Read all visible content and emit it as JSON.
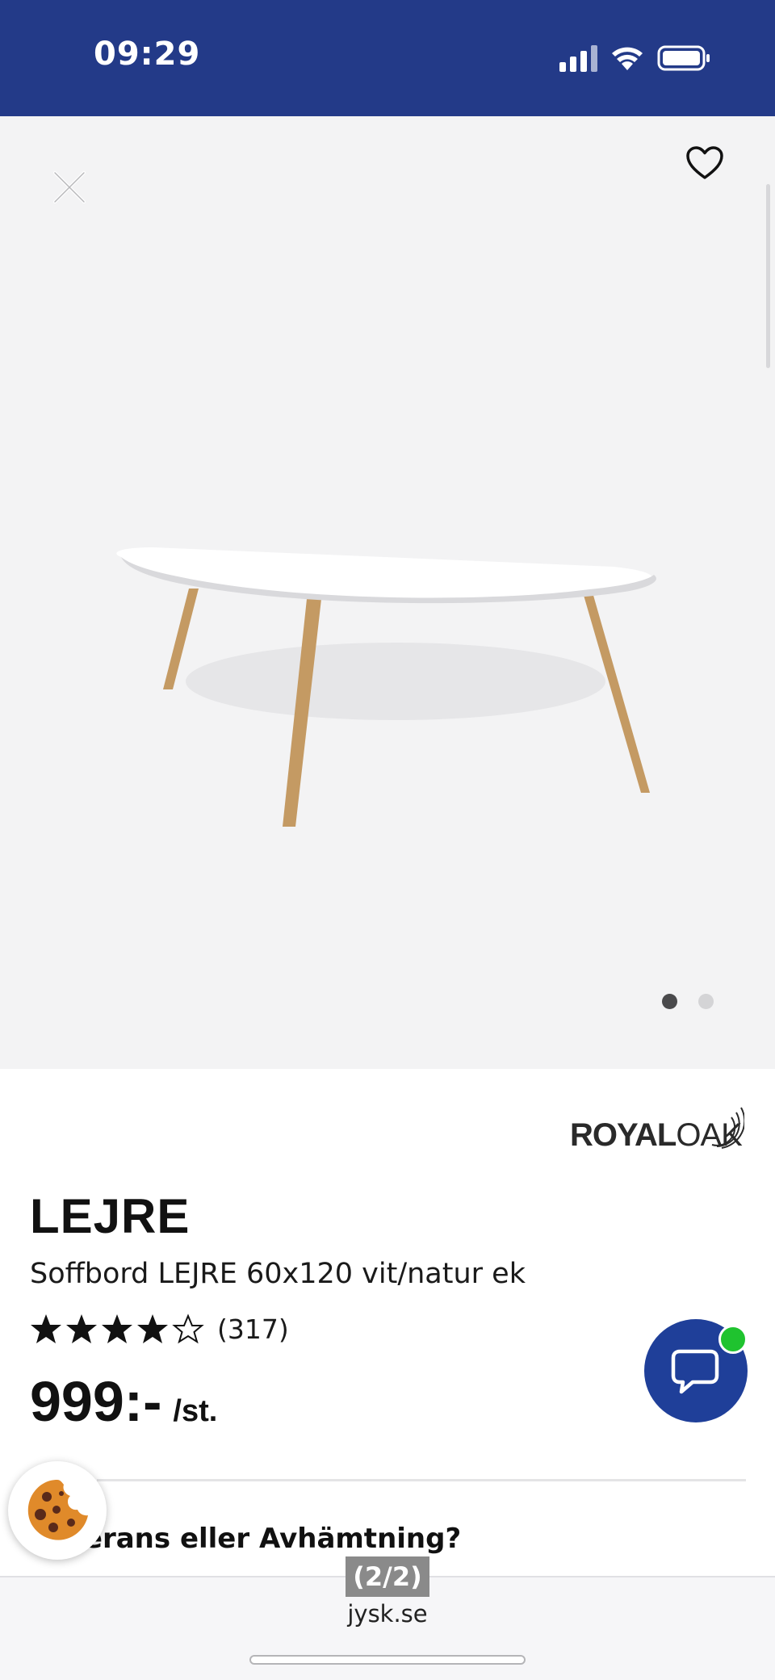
{
  "status_bar": {
    "time": "09:29",
    "icons": [
      "cellular-signal-icon",
      "wifi-icon",
      "battery-icon"
    ]
  },
  "gallery": {
    "close_icon": "close-icon",
    "favorite_icon": "heart-icon",
    "image_description_icon": "product-image",
    "pages": 2,
    "active_page": 1
  },
  "product": {
    "brand": "ROYAL OAK",
    "brand_bold": "ROYAL",
    "brand_thin": "OAK",
    "name": "LEJRE",
    "subtitle": "Soffbord LEJRE 60x120 vit/natur ek",
    "rating": 4,
    "rating_max": 5,
    "rating_count": "(317)",
    "price": "999:-",
    "price_unit": "/st."
  },
  "delivery": {
    "heading": "Leverans eller Avhämtning?"
  },
  "chat": {
    "icon": "chat-bubble-icon",
    "online_color": "#1fc32f"
  },
  "browser": {
    "page_indicator": "(2/2)",
    "url": "jysk.se"
  },
  "colors": {
    "header_blue": "#233a88",
    "chat_blue": "#1f3f99",
    "gallery_bg": "#f3f3f4"
  }
}
